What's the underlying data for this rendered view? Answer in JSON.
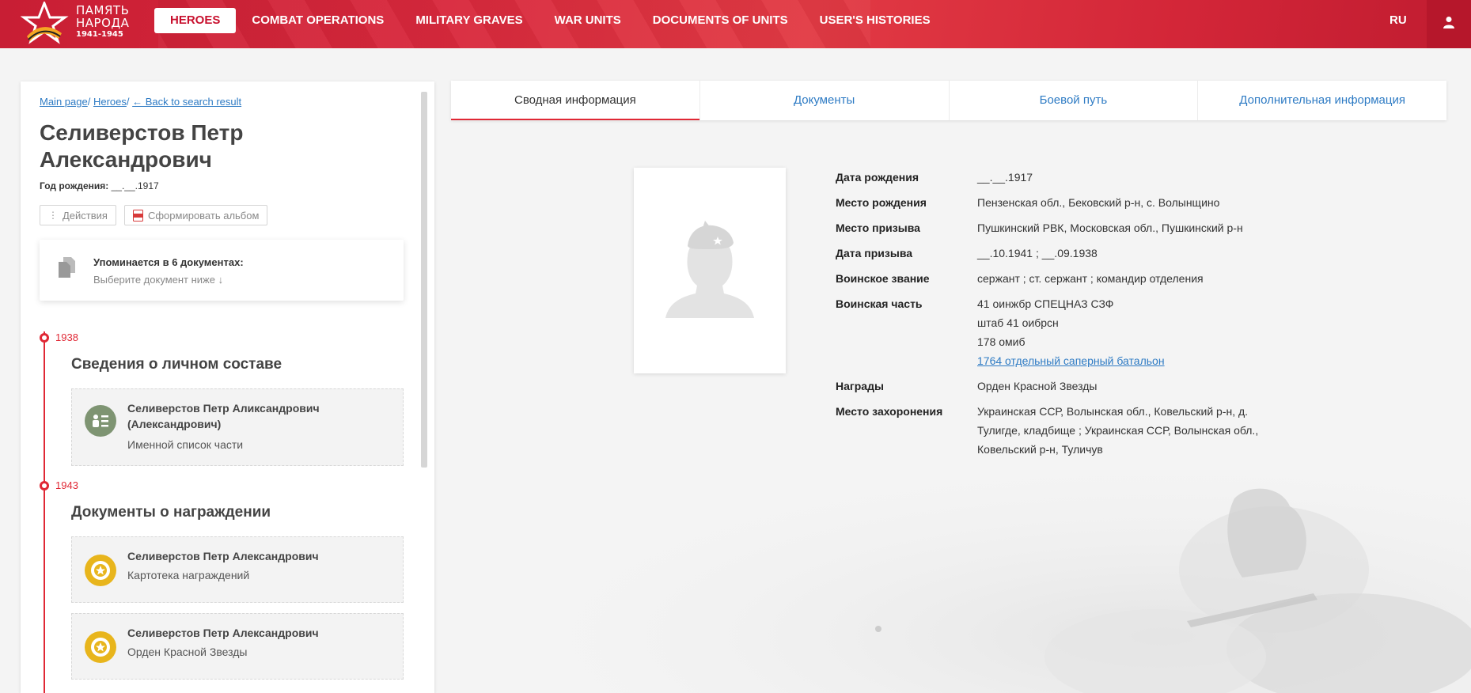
{
  "header": {
    "logo": {
      "line1": "ПАМЯТЬ",
      "line2": "НАРОДА",
      "years": "1941-1945"
    },
    "nav": [
      {
        "label": "HEROES",
        "active": true
      },
      {
        "label": "COMBAT OPERATIONS",
        "active": false
      },
      {
        "label": "MILITARY GRAVES",
        "active": false
      },
      {
        "label": "WAR UNITS",
        "active": false
      },
      {
        "label": "DOCUMENTS OF UNITS",
        "active": false
      },
      {
        "label": "USER'S HISTORIES",
        "active": false
      }
    ],
    "lang": "RU",
    "user_icon": "user-icon"
  },
  "breadcrumb": {
    "main": "Main page",
    "heroes": "Heroes",
    "back": "← Back to search result",
    "sep": "/"
  },
  "hero": {
    "name": "Селиверстов Петр Александрович",
    "birth_label": "Год рождения:",
    "birth_value": "__.__.1917"
  },
  "actions": {
    "actions_label": "Действия",
    "album_label": "Сформировать альбом"
  },
  "mentions": {
    "title": "Упоминается в 6 документах:",
    "subtitle": "Выберите документ ниже ↓"
  },
  "timeline": [
    {
      "year": "1938",
      "heading": "Сведения о личном составе",
      "cards": [
        {
          "name": "Селиверстов Петр Аликсандрович (Александрович)",
          "type": "Именной список части",
          "icon": "personnel-list-icon"
        }
      ]
    },
    {
      "year": "1943",
      "heading": "Документы о награждении",
      "cards": [
        {
          "name": "Селиверстов Петр Александрович",
          "type": "Картотека награждений",
          "icon": "medal-icon"
        },
        {
          "name": "Селиверстов Петр Александрович",
          "type": "Орден Красной Звезды",
          "icon": "medal-icon"
        }
      ]
    }
  ],
  "tabs": [
    {
      "label": "Сводная информация",
      "active": true
    },
    {
      "label": "Документы",
      "active": false
    },
    {
      "label": "Боевой путь",
      "active": false
    },
    {
      "label": "Дополнительная информация",
      "active": false
    }
  ],
  "info": {
    "birth_date": {
      "label": "Дата рождения",
      "value": "__.__.1917"
    },
    "birth_place": {
      "label": "Место рождения",
      "value": "Пензенская обл., Бековский р-н, с. Волынщино"
    },
    "draft_place": {
      "label": "Место призыва",
      "value": "Пушкинский РВК, Московская обл., Пушкинский р-н"
    },
    "draft_date": {
      "label": "Дата призыва",
      "value": "__.10.1941 ; __.09.1938"
    },
    "rank": {
      "label": "Воинское звание",
      "value": "сержант ; ст. сержант ; командир отделения"
    },
    "unit": {
      "label": "Воинская часть",
      "lines": [
        "41 оинжбр СПЕЦНАЗ СЗФ",
        "штаб 41 оибрсн",
        "178 омиб"
      ],
      "link": "1764 отдельный саперный батальон"
    },
    "awards": {
      "label": "Награды",
      "value": "Орден Красной Звезды"
    },
    "burial": {
      "label": "Место захоронения",
      "value": "Украинская ССР, Волынская обл., Ковельский р-н, д. Тулигде, кладбище ; Украинская ССР, Волынская обл., Ковельский р-н, Туличув"
    }
  }
}
